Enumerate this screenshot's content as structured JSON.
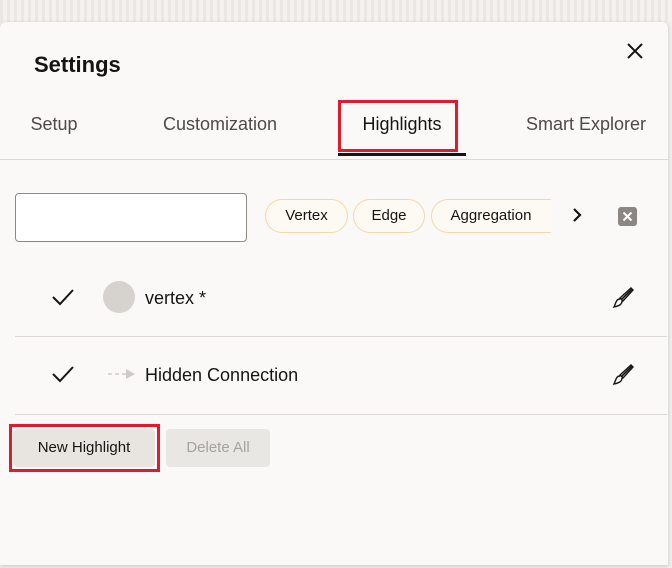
{
  "dialog": {
    "title": "Settings",
    "close_icon": "close-icon"
  },
  "tabs": [
    {
      "label": "Setup",
      "active": false
    },
    {
      "label": "Customization",
      "active": false
    },
    {
      "label": "Highlights",
      "active": true
    },
    {
      "label": "Smart Explorer",
      "active": false
    }
  ],
  "filter": {
    "search_value": "",
    "chips": [
      "Vertex",
      "Edge",
      "Aggregation"
    ],
    "next_icon": "chevron-right-icon",
    "clear_icon": "clear-x-icon"
  },
  "highlights": [
    {
      "label": "vertex *",
      "enabled": true,
      "icon": "vertex-circle-icon",
      "edit_icon": "paintbrush-icon"
    },
    {
      "label": "Hidden Connection",
      "enabled": true,
      "icon": "edge-arrow-icon",
      "edit_icon": "paintbrush-icon"
    }
  ],
  "actions": {
    "new_label": "New Highlight",
    "delete_all_label": "Delete All",
    "delete_all_disabled": true
  },
  "colors": {
    "annotation_red": "#e21a2c",
    "chip_border": "#f2d8a8",
    "text": "#161513"
  }
}
